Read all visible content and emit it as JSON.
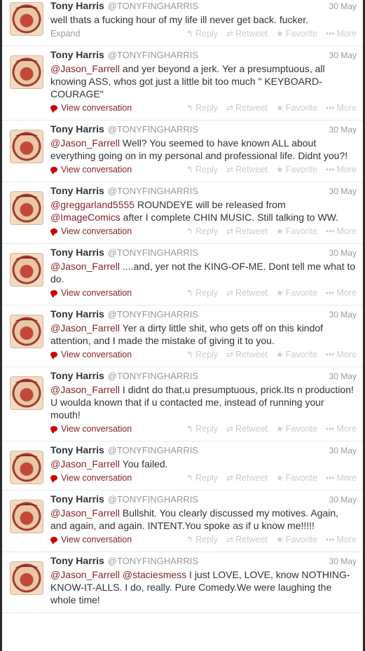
{
  "tweets": [
    {
      "name": "Tony Harris",
      "handle": "@TONYFINGHARRIS",
      "date": "30 May",
      "text": [
        {
          "t": "well thats a fucking hour of my life ill never get back. fucker."
        }
      ],
      "footer_label": "Expand",
      "footer_type": "expand"
    },
    {
      "name": "Tony Harris",
      "handle": "@TONYFINGHARRIS",
      "date": "30 May",
      "text": [
        {
          "t": "@Jason_Farrell",
          "m": true
        },
        {
          "t": " and yer beyond a jerk. Yer a presumptuous, all knowing ASS, whos got just a little bit too much \" KEYBOARD-COURAGE\""
        }
      ],
      "footer_label": "View conversation",
      "footer_type": "conversation"
    },
    {
      "name": "Tony Harris",
      "handle": "@TONYFINGHARRIS",
      "date": "30 May",
      "text": [
        {
          "t": "@Jason_Farrell",
          "m": true
        },
        {
          "t": " Well? You seemed to have known ALL about everything going on in my personal and professional life. Didnt you?!"
        }
      ],
      "footer_label": "View conversation",
      "footer_type": "conversation"
    },
    {
      "name": "Tony Harris",
      "handle": "@TONYFINGHARRIS",
      "date": "30 May",
      "text": [
        {
          "t": "@greggarland5555",
          "m": true
        },
        {
          "t": " ROUNDEYE will be released from "
        },
        {
          "t": "@ImageComics",
          "m": true
        },
        {
          "t": " after I complete CHIN MUSIC. Still talking to WW."
        }
      ],
      "footer_label": "View conversation",
      "footer_type": "conversation"
    },
    {
      "name": "Tony Harris",
      "handle": "@TONYFINGHARRIS",
      "date": "30 May",
      "text": [
        {
          "t": "@Jason_Farrell",
          "m": true
        },
        {
          "t": " ....and, yer not the KING-OF-ME. Dont tell me what to do."
        }
      ],
      "footer_label": "View conversation",
      "footer_type": "conversation"
    },
    {
      "name": "Tony Harris",
      "handle": "@TONYFINGHARRIS",
      "date": "30 May",
      "text": [
        {
          "t": "@Jason_Farrell",
          "m": true
        },
        {
          "t": " Yer a dirty little shit, who gets off on this kindof attention, and I made the mistake of giving it to you."
        }
      ],
      "footer_label": "View conversation",
      "footer_type": "conversation"
    },
    {
      "name": "Tony Harris",
      "handle": "@TONYFINGHARRIS",
      "date": "30 May",
      "text": [
        {
          "t": "@Jason_Farrell",
          "m": true
        },
        {
          "t": " I didnt do that,u presumptuous, prick.Its n production! U woulda known that if u contacted me, instead of running your mouth!"
        }
      ],
      "footer_label": "View conversation",
      "footer_type": "conversation"
    },
    {
      "name": "Tony Harris",
      "handle": "@TONYFINGHARRIS",
      "date": "30 May",
      "text": [
        {
          "t": "@Jason_Farrell",
          "m": true
        },
        {
          "t": " You failed."
        }
      ],
      "footer_label": "View conversation",
      "footer_type": "conversation"
    },
    {
      "name": "Tony Harris",
      "handle": "@TONYFINGHARRIS",
      "date": "30 May",
      "text": [
        {
          "t": "@Jason_Farrell",
          "m": true
        },
        {
          "t": " Bullshit. You clearly discussed my motives. Again, and again, and again. INTENT.You spoke as if u know me!!!!!"
        }
      ],
      "footer_label": "View conversation",
      "footer_type": "conversation"
    },
    {
      "name": "Tony Harris",
      "handle": "@TONYFINGHARRIS",
      "date": "30 May",
      "text": [
        {
          "t": "@Jason_Farrell",
          "m": true
        },
        {
          "t": " "
        },
        {
          "t": "@staciesmess",
          "m": true
        },
        {
          "t": " I just LOVE, LOVE, know NOTHING-KNOW-IT-ALLS. I do, really. Pure Comedy.We were laughing the whole time!"
        }
      ],
      "footer_label": "",
      "footer_type": "none"
    }
  ],
  "actions": {
    "reply": {
      "label": "Reply",
      "icon": "reply-icon"
    },
    "retweet": {
      "label": "Retweet",
      "icon": "retweet-icon"
    },
    "favorite": {
      "label": "Favorite",
      "icon": "star-icon"
    },
    "more": {
      "label": "More",
      "icon": "ellipsis-icon"
    }
  },
  "colors": {
    "mention": "#862424",
    "conversation_link": "#862424",
    "muted": "#999999",
    "action_text": "#cccccc",
    "bubble_icon": "#cc0000"
  }
}
